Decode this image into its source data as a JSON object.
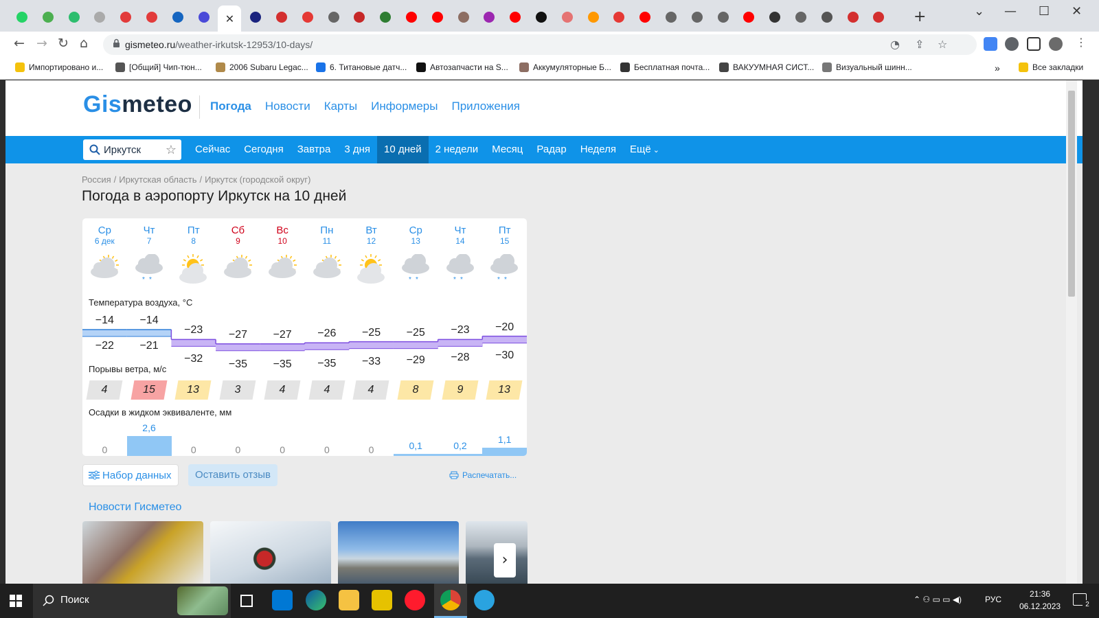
{
  "browser": {
    "tab_favicon_colors": [
      "#25d366",
      "#4caf50",
      "#2dbd6e",
      "#aaaaaa",
      "#e23b3b",
      "#e23b3b",
      "#1565c0",
      "#4a4ad8",
      "#ffffff",
      "#1a237e",
      "#d32f2f",
      "#e53935",
      "#666666",
      "#c62828",
      "#2e7d32",
      "#ff0000",
      "#ff0000",
      "#8d6e63",
      "#9c27b0",
      "#ff0000",
      "#111111",
      "#e57373",
      "#ff9800",
      "#e53935",
      "#ff0000",
      "#666666",
      "#666666",
      "#666666",
      "#ff0000",
      "#333333",
      "#666666",
      "#555555",
      "#d32f2f",
      "#d32f2f"
    ],
    "active_tab_close": "✕",
    "new_tab": "+",
    "window_controls": {
      "minimize": "—",
      "maximize": "☐",
      "close": "✕",
      "tab_search": "⌄"
    },
    "url_host": "gismeteo.ru",
    "url_path": "/weather-irkutsk-12953/10-days/",
    "bookmarks": [
      {
        "label": "Импортировано и...",
        "color": "#f4c20d"
      },
      {
        "label": "[Общий] Чип-тюн...",
        "color": "#555555"
      },
      {
        "label": "2006 Subaru Legac...",
        "color": "#b08a4a"
      },
      {
        "label": "6. Титановые датч...",
        "color": "#1a73e8"
      },
      {
        "label": "Автозапчасти на S...",
        "color": "#111111"
      },
      {
        "label": "Аккумуляторные Б...",
        "color": "#8d6e63"
      },
      {
        "label": "Бесплатная почта...",
        "color": "#333333"
      },
      {
        "label": "ВАКУУМНАЯ СИСТ...",
        "color": "#444444"
      },
      {
        "label": "Визуальный шинн...",
        "color": "#777777"
      }
    ],
    "bookmarks_overflow": "»",
    "all_bookmarks": "Все закладки"
  },
  "site": {
    "logo_part1": "Gis",
    "logo_part2": "meteo",
    "main_nav": [
      "Погода",
      "Новости",
      "Карты",
      "Информеры",
      "Приложения"
    ],
    "search_value": "Иркутск",
    "sub_nav": [
      "Сейчас",
      "Сегодня",
      "Завтра",
      "3 дня",
      "10 дней",
      "2 недели",
      "Месяц",
      "Радар",
      "Неделя",
      "Ещё"
    ],
    "sub_nav_active": "10 дней",
    "breadcrumb": [
      "Россия",
      "Иркутская область",
      "Иркутск (городской округ)"
    ],
    "breadcrumb_sep": "/",
    "title": "Погода в аэропорту Иркутск на 10 дней"
  },
  "forecast": {
    "days": [
      {
        "name": "Ср",
        "date": "6 дек",
        "weekend": false,
        "icon": "partly-cloudy-sun-icon",
        "tmax": "−14",
        "tmin": "−22",
        "gust": "4",
        "gust_color": "#e4e4e4",
        "precip": "0",
        "precip_mm": 0
      },
      {
        "name": "Чт",
        "date": "7",
        "weekend": false,
        "icon": "cloudy-snow-icon",
        "tmax": "−14",
        "tmin": "−21",
        "gust": "15",
        "gust_color": "#f7a3a3",
        "precip": "2,6",
        "precip_mm": 2.6
      },
      {
        "name": "Пт",
        "date": "8",
        "weekend": false,
        "icon": "sun-cloud-icon",
        "tmax": "−23",
        "tmin": "−32",
        "gust": "13",
        "gust_color": "#fde7a6",
        "precip": "0",
        "precip_mm": 0
      },
      {
        "name": "Сб",
        "date": "9",
        "weekend": true,
        "icon": "partly-cloudy-sun-icon",
        "tmax": "−27",
        "tmin": "−35",
        "gust": "3",
        "gust_color": "#e4e4e4",
        "precip": "0",
        "precip_mm": 0
      },
      {
        "name": "Вс",
        "date": "10",
        "weekend": true,
        "icon": "partly-cloudy-sun-icon",
        "tmax": "−27",
        "tmin": "−35",
        "gust": "4",
        "gust_color": "#e4e4e4",
        "precip": "0",
        "precip_mm": 0
      },
      {
        "name": "Пн",
        "date": "11",
        "weekend": false,
        "icon": "partly-cloudy-sun-icon",
        "tmax": "−26",
        "tmin": "−35",
        "gust": "4",
        "gust_color": "#e4e4e4",
        "precip": "0",
        "precip_mm": 0
      },
      {
        "name": "Вт",
        "date": "12",
        "weekend": false,
        "icon": "sun-cloud-icon",
        "tmax": "−25",
        "tmin": "−33",
        "gust": "4",
        "gust_color": "#e4e4e4",
        "precip": "0",
        "precip_mm": 0
      },
      {
        "name": "Ср",
        "date": "13",
        "weekend": false,
        "icon": "cloudy-snow-icon",
        "tmax": "−25",
        "tmin": "−29",
        "gust": "8",
        "gust_color": "#fde7a6",
        "precip": "0,1",
        "precip_mm": 0.1
      },
      {
        "name": "Чт",
        "date": "14",
        "weekend": false,
        "icon": "cloudy-snow-icon",
        "tmax": "−23",
        "tmin": "−28",
        "gust": "9",
        "gust_color": "#fde7a6",
        "precip": "0,2",
        "precip_mm": 0.2
      },
      {
        "name": "Пт",
        "date": "15",
        "weekend": false,
        "icon": "cloudy-snow-icon",
        "tmax": "−20",
        "tmin": "−30",
        "gust": "13",
        "gust_color": "#fde7a6",
        "precip": "1,1",
        "precip_mm": 1.1
      }
    ],
    "temp_label": "Температура воздуха, °C",
    "gust_label": "Порывы ветра, м/с",
    "precip_label": "Осадки в жидком эквиваленте, мм",
    "colors": {
      "warm_band": "#b4d3f7",
      "cold_band": "#c8b4f5",
      "band_line": "#7d4ee0",
      "warm_line": "#2f7ed8",
      "precip_text": "#2a8fe6",
      "zero_text": "#888888"
    }
  },
  "actions": {
    "dataset_button": "Набор данных",
    "feedback_button": "Оставить отзыв",
    "print_link": "Распечатать..."
  },
  "news": {
    "title": "Новости Гисметео",
    "next": "›"
  },
  "taskbar": {
    "search_placeholder": "Поиск",
    "lang": "РУС",
    "time": "21:36",
    "date": "06.12.2023",
    "notifications": "2"
  }
}
